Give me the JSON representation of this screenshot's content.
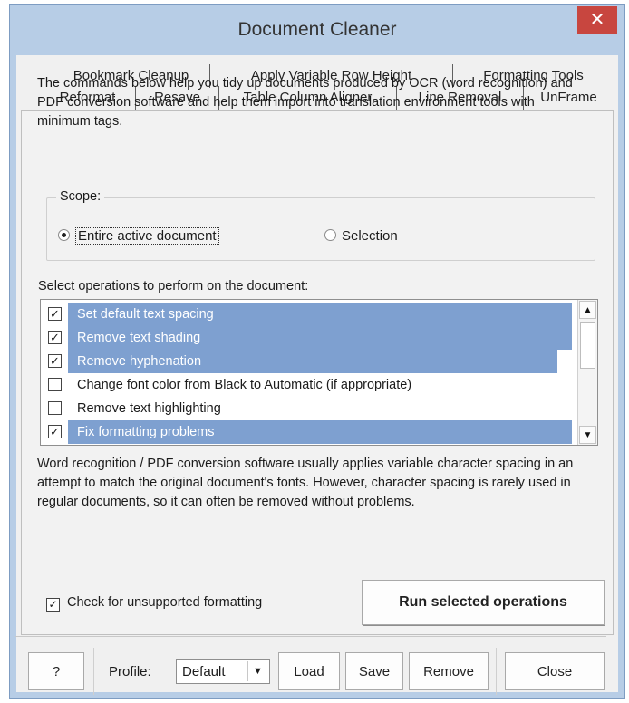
{
  "window": {
    "title": "Document Cleaner",
    "close_glyph": "✕"
  },
  "tabs": {
    "back_row": [
      {
        "label": "Bookmark Cleanup"
      },
      {
        "label": "Apply Variable Row Height"
      },
      {
        "label": "Formatting Tools"
      }
    ],
    "front_row": [
      {
        "label": "Reformat",
        "selected": true
      },
      {
        "label": "Resave"
      },
      {
        "label": "Table Column Aligner"
      },
      {
        "label": "Line Removal"
      },
      {
        "label": "UnFrame"
      }
    ]
  },
  "intro_text": "The commands below help you tidy up documents produced by OCR (word recognition) and PDF conversion software and help them import into translation environment tools with minimum tags.",
  "scope": {
    "label": "Scope:",
    "options": [
      {
        "label": "Entire active document",
        "checked": true
      },
      {
        "label": "Selection",
        "checked": false
      }
    ]
  },
  "operations": {
    "label": "Select operations to perform on the document:",
    "items": [
      {
        "label": "Set default text spacing",
        "checked": true,
        "selected": true
      },
      {
        "label": "Remove text shading",
        "checked": true,
        "selected": true
      },
      {
        "label": "Remove hyphenation",
        "checked": true,
        "selected": true
      },
      {
        "label": "Change font color from Black to Automatic (if appropriate)",
        "checked": false,
        "selected": false
      },
      {
        "label": "Remove text highlighting",
        "checked": false,
        "selected": false
      },
      {
        "label": "Fix formatting problems",
        "checked": true,
        "selected": true
      }
    ],
    "scroll_up_glyph": "▲",
    "scroll_down_glyph": "▼"
  },
  "description": "Word recognition / PDF conversion software usually applies variable character spacing in an attempt to match the original document's fonts. However, character spacing is rarely used in regular documents, so it can often be removed without problems.",
  "check_unsupported": {
    "label": "Check for unsupported formatting",
    "checked": true
  },
  "run_button": "Run selected operations",
  "footer": {
    "help_label": "?",
    "profile_label": "Profile:",
    "profile_value": "Default",
    "dropdown_glyph": "▼",
    "load_label": "Load",
    "save_label": "Save",
    "remove_label": "Remove",
    "close_label": "Close"
  },
  "colors": {
    "title_bg": "#b7cde6",
    "close_bg": "#c8463f",
    "selection_bg": "#7ea0d0"
  }
}
